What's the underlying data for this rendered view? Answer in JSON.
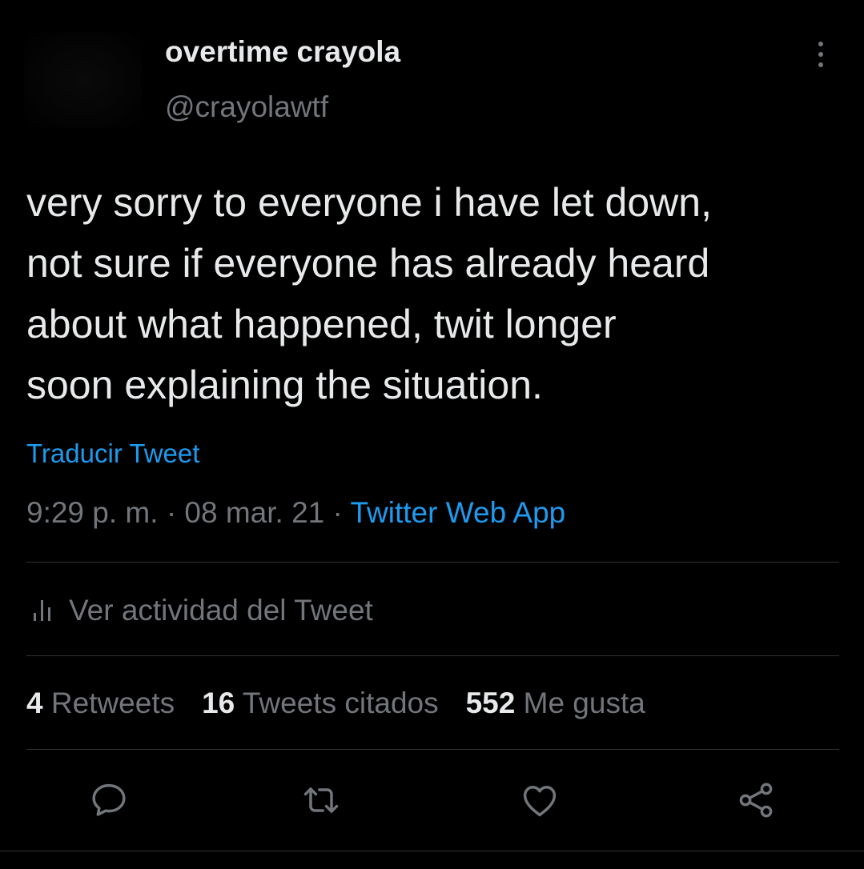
{
  "header": {
    "display_name": "overtime crayola",
    "handle": "@crayolawtf"
  },
  "tweet": {
    "lines": [
      "very sorry to everyone i have let down,",
      "not sure if everyone has already heard",
      "about what happened, twit longer",
      "soon explaining the situation."
    ],
    "translate_label": "Traducir Tweet",
    "time": "9:29 p. m.",
    "separator": "·",
    "date": "08 mar. 21",
    "source": "Twitter Web App"
  },
  "activity": {
    "label": "Ver actividad del Tweet"
  },
  "stats": {
    "retweets_count": "4",
    "retweets_label": "Retweets",
    "quotes_count": "16",
    "quotes_label": "Tweets citados",
    "likes_count": "552",
    "likes_label": "Me gusta"
  },
  "actions": {
    "icons": [
      "reply-icon",
      "retweet-icon",
      "like-icon",
      "share-icon"
    ]
  },
  "colors": {
    "background": "#000000",
    "text_primary": "#e7e9ea",
    "text_secondary": "#71767b",
    "accent": "#1d9bf0",
    "divider": "#2f3336"
  }
}
